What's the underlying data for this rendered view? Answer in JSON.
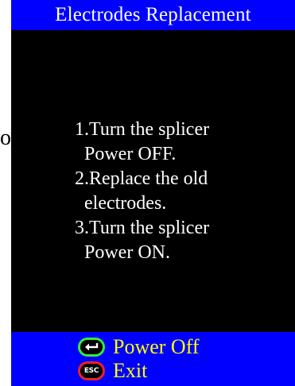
{
  "edge_fragment": "o",
  "title": "Electrodes Replacement",
  "instructions": [
    "1.Turn the splicer",
    "  Power OFF.",
    "2.Replace the old",
    "  electrodes.",
    "3.Turn the splicer",
    "  Power ON."
  ],
  "footer": {
    "power_off": {
      "icon": "enter-icon",
      "label": "Power Off"
    },
    "exit": {
      "icon": "esc-key-icon",
      "key_text": "ESC",
      "label": "Exit"
    }
  },
  "colors": {
    "bar": "#0000ff",
    "screen": "#000000",
    "title_text": "#ffffff",
    "footer_text": "#ffff00",
    "enter_key": "#33ee33",
    "esc_key": "#ee2222"
  }
}
